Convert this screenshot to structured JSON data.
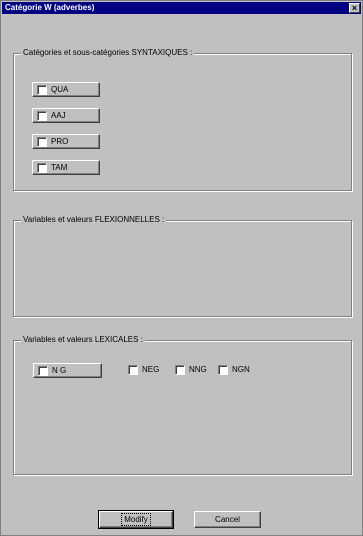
{
  "window": {
    "title": "Catégorie W (adverbes)",
    "close_glyph": "×"
  },
  "syntax_group": {
    "title": "Catégories et sous-catégories SYNTAXIQUES :",
    "buttons": [
      "QUA",
      "AAJ",
      "PRO",
      "TAM"
    ]
  },
  "flex_group": {
    "title": "Variables et valeurs FLEXIONNELLES :"
  },
  "lex_group": {
    "title": "Variables et valeurs LEXICALES :",
    "button_label": "N G",
    "checkboxes": [
      "NEG",
      "NNG",
      "NGN"
    ]
  },
  "actions": {
    "modify_label": "Modify",
    "cancel_label": "Cancel"
  }
}
